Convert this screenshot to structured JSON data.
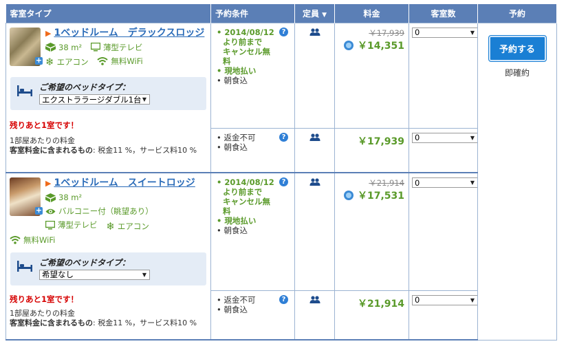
{
  "headers": {
    "room_type": "客室タイプ",
    "conditions": "予約条件",
    "capacity": "定員",
    "price": "料金",
    "rooms": "客室数",
    "booking": "予約"
  },
  "booking": {
    "button_label": "予約する",
    "instant_label": "即確約"
  },
  "rooms": [
    {
      "name": "1ベッドルーム　デラックスロッジ",
      "features": [
        "38 m²",
        "薄型テレビ",
        "エアコン",
        "無料WiFi"
      ],
      "bed_label": "ご希望のベッドタイプ：",
      "bed_value": "エクストララージダブル1台",
      "few_left": "残りあと1室です！",
      "price_note": "1部屋あたりの料金",
      "included_label": "客室料金に含まれるもの",
      "included_value": ": 税金11 %，サービス料10 %",
      "rates": [
        {
          "lines": [
            "2014/08/12",
            "より前まで",
            "キャンセル無",
            "料",
            "現地払い",
            "朝食込"
          ],
          "old_price": "￥17,939",
          "price": "￥14,351",
          "qty": "0"
        },
        {
          "lines": [
            "返金不可",
            "朝食込"
          ],
          "old_price": "",
          "price": "￥17,939",
          "qty": "0"
        }
      ]
    },
    {
      "name": "1ベッドルーム　スイートロッジ",
      "features": [
        "38 m²",
        "バルコニー付（眺望あり）",
        "薄型テレビ",
        "エアコン",
        "無料WiFi"
      ],
      "bed_label": "ご希望のベッドタイプ：",
      "bed_value": "希望なし",
      "few_left": "残りあと1室です！",
      "price_note": "1部屋あたりの料金",
      "included_label": "客室料金に含まれるもの",
      "included_value": ": 税金11 %，サービス料10 %",
      "rates": [
        {
          "lines": [
            "2014/08/12",
            "より前まで",
            "キャンセル無",
            "料",
            "現地払い",
            "朝食込"
          ],
          "old_price": "￥21,914",
          "price": "￥17,531",
          "qty": "0"
        },
        {
          "lines": [
            "返金不可",
            "朝食込"
          ],
          "old_price": "",
          "price": "￥21,914",
          "qty": "0"
        }
      ]
    }
  ],
  "colors": {
    "header_bg": "#5b7fb6",
    "green": "#5a9a2a",
    "link": "#2a6bb8",
    "alert": "#d60000",
    "button": "#1a7fd4"
  },
  "icons": [
    "size-icon",
    "tv-icon",
    "ac-icon",
    "wifi-icon",
    "balcony-view-icon",
    "bed-icon",
    "help-icon",
    "persons-icon",
    "discount-icon",
    "chevron-down-icon",
    "plus-icon"
  ]
}
